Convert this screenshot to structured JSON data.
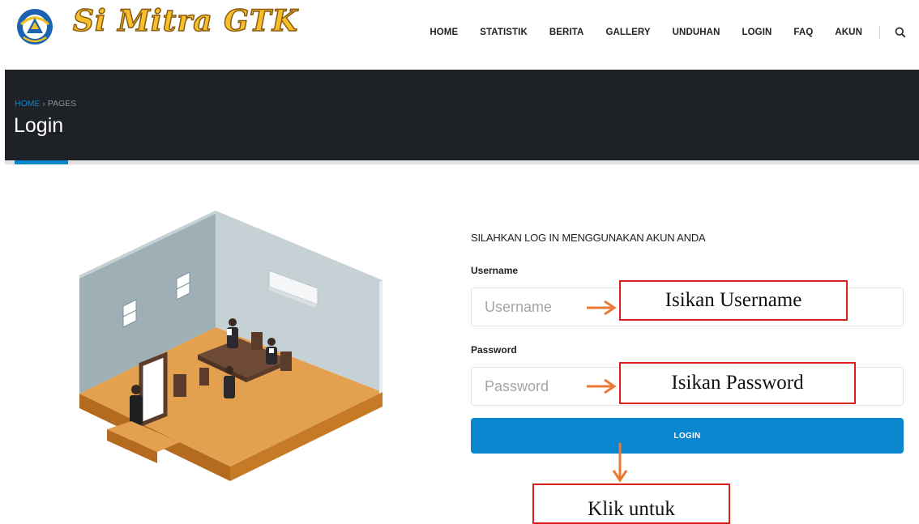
{
  "header": {
    "logo_text": "Si Mitra GTK",
    "nav": [
      "HOME",
      "STATISTIK",
      "BERITA",
      "GALLERY",
      "UNDUHAN",
      "LOGIN",
      "FAQ",
      "AKUN"
    ]
  },
  "titlebar": {
    "crumb_home": "HOME",
    "crumb_sep": "›",
    "crumb_current": "PAGES",
    "title": "Login"
  },
  "form": {
    "heading": "SILAHKAN LOG IN MENGGUNAKAN AKUN ANDA",
    "username_label": "Username",
    "username_placeholder": "Username",
    "username_value": "",
    "password_label": "Password",
    "password_placeholder": "Password",
    "password_value": "",
    "login_label": "LOGIN"
  },
  "annotations": {
    "username_note": "Isikan Username",
    "password_note": "Isikan Password",
    "login_note": "Klik untuk"
  },
  "colors": {
    "accent": "#0a86ce",
    "titlebar": "#1e2126",
    "annotation_border": "#d9201b",
    "arrow": "#ea7a33"
  },
  "icons": {
    "emblem": "tut-wuri-handayani-emblem",
    "search": "search-icon"
  }
}
